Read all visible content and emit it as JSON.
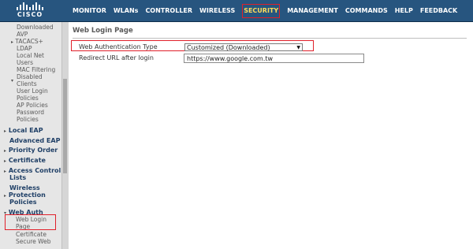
{
  "brand": {
    "name": "CISCO"
  },
  "nav": [
    {
      "label": "MONITOR"
    },
    {
      "label": "WLANs"
    },
    {
      "label": "CONTROLLER"
    },
    {
      "label": "WIRELESS"
    },
    {
      "label": "SECURITY",
      "active": true
    },
    {
      "label": "MANAGEMENT"
    },
    {
      "label": "COMMANDS"
    },
    {
      "label": "HELP"
    },
    {
      "label": "FEEDBACK"
    }
  ],
  "sidebar": {
    "items": [
      "Downloaded",
      "AVP",
      "TACACS+",
      "LDAP",
      "Local Net",
      "Users",
      "MAC Filtering",
      "Disabled",
      "Clients",
      "User Login",
      "Policies",
      "AP Policies",
      "Password",
      "Policies"
    ],
    "sections": [
      "Local EAP",
      "Advanced EAP",
      "Priority Order",
      "Certificate",
      "Access Control",
      "Lists",
      "Wireless",
      "Protection",
      "Policies",
      "Web Auth"
    ],
    "web_auth_items": [
      "Web Login",
      "Page",
      "Certificate",
      "Secure Web"
    ]
  },
  "page": {
    "title": "Web Login Page",
    "web_auth_type_label": "Web Authentication Type",
    "web_auth_type_value": "Customized (Downloaded)",
    "redirect_label": "Redirect URL after login",
    "redirect_value": "https://www.google.com.tw"
  },
  "colors": {
    "nav_bg": "#27557f",
    "active_nav": "#ffdc5a",
    "highlight": "#e0202a"
  }
}
